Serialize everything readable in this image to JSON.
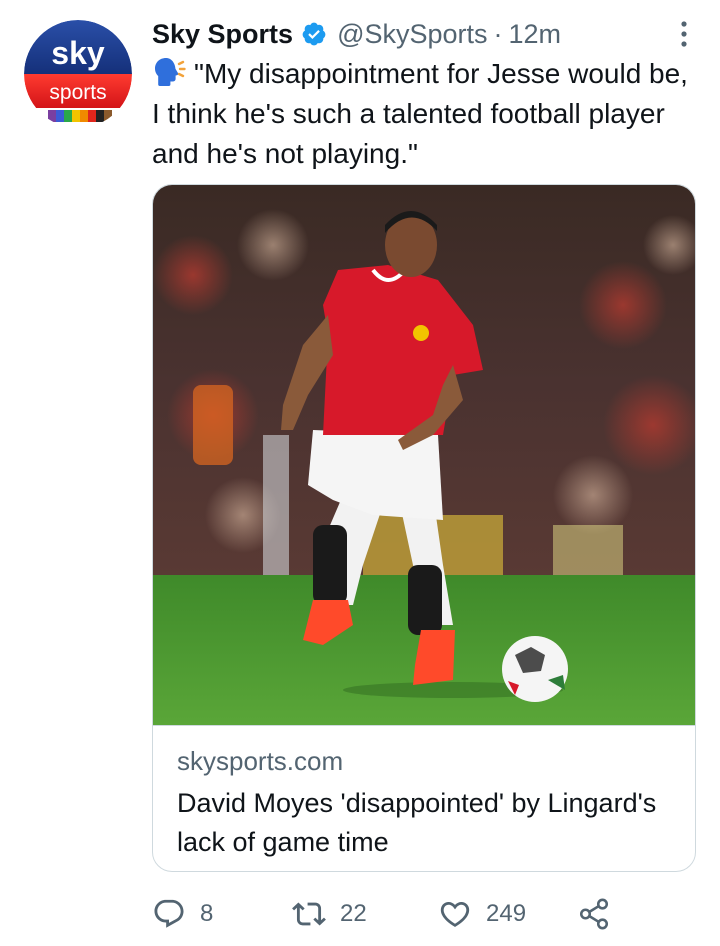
{
  "author": {
    "display_name": "Sky Sports",
    "handle": "@SkySports",
    "separator": "·",
    "time": "12m",
    "avatar": {
      "brand": "sky",
      "subbrand": "sports"
    },
    "verified_icon": "verified-badge-icon"
  },
  "tweet": {
    "emoji": "speaking-head",
    "text": "\"My disappointment for Jesse would be, I think he's such a talented football player and he's not playing.\""
  },
  "card": {
    "image": "Footballer in red kit dribbling a ball on pitch",
    "domain": "skysports.com",
    "title": "David Moyes 'disappointed' by Lingard's lack of game time"
  },
  "actions": {
    "replies": "8",
    "retweets": "22",
    "likes": "249",
    "icons": [
      "reply-icon",
      "retweet-icon",
      "like-icon",
      "share-icon"
    ]
  },
  "colors": {
    "text": "#0f1419",
    "secondary": "#536471",
    "verified": "#1d9bf0",
    "border": "#cfd9de",
    "sky_blue": "#1f3c8c",
    "sky_red": "#e3262b"
  }
}
